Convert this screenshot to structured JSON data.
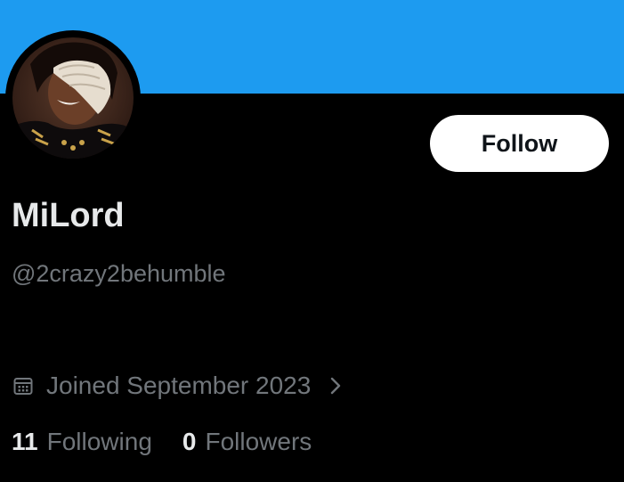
{
  "profile": {
    "display_name": "MiLord",
    "handle": "@2crazy2behumble",
    "joined": "Joined September 2023",
    "avatar_icon": "profile-photo",
    "banner_color": "#1d9bf0"
  },
  "actions": {
    "follow_label": "Follow"
  },
  "stats": {
    "following_count": "11",
    "following_label": "Following",
    "followers_count": "0",
    "followers_label": "Followers"
  },
  "icons": {
    "calendar": "calendar-icon",
    "chevron": "chevron-right-icon"
  },
  "colors": {
    "background": "#000000",
    "primary_text": "#e7e9ea",
    "secondary_text": "#71767b",
    "button_bg": "#ffffff",
    "button_text": "#0f1419"
  }
}
